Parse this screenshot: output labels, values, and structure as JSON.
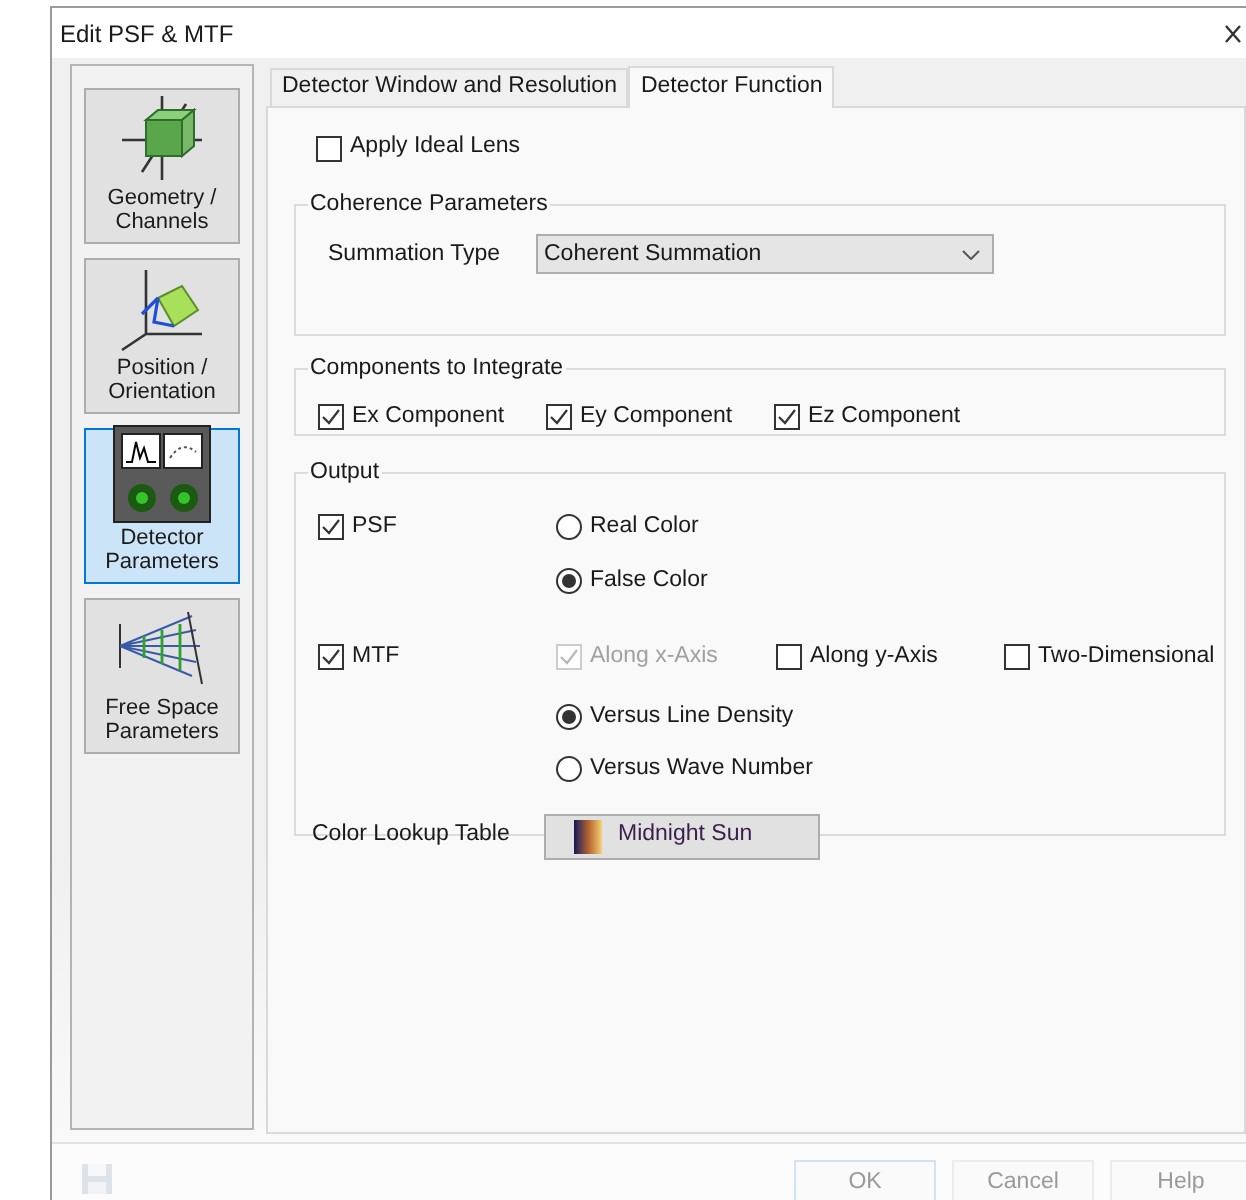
{
  "window": {
    "title": "Edit PSF & MTF"
  },
  "sidebar": {
    "items": [
      {
        "label": "Geometry / Channels",
        "kind": "geometry",
        "selected": false
      },
      {
        "label": "Position / Orientation",
        "kind": "position",
        "selected": false
      },
      {
        "label": "Detector Parameters",
        "kind": "detector",
        "selected": true
      },
      {
        "label": "Free Space Parameters",
        "kind": "freespace",
        "selected": false
      }
    ]
  },
  "tabs": [
    {
      "label": "Detector Window and Resolution",
      "selected": false
    },
    {
      "label": "Detector Function",
      "selected": true
    }
  ],
  "apply_ideal_lens": {
    "label": "Apply Ideal Lens",
    "checked": false
  },
  "coherence": {
    "title": "Coherence Parameters",
    "summation_type": {
      "label": "Summation Type",
      "value": "Coherent Summation"
    }
  },
  "components": {
    "title": "Components to Integrate",
    "items": [
      {
        "label": "Ex Component",
        "checked": true
      },
      {
        "label": "Ey Component",
        "checked": true
      },
      {
        "label": "Ez Component",
        "checked": true
      }
    ]
  },
  "output": {
    "title": "Output",
    "psf": {
      "label": "PSF",
      "checked": true,
      "options": [
        {
          "label": "Real Color",
          "selected": false
        },
        {
          "label": "False Color",
          "selected": true
        }
      ]
    },
    "mtf": {
      "label": "MTF",
      "checked": true,
      "axes": [
        {
          "label": "Along x-Axis",
          "checked": true,
          "disabled": true
        },
        {
          "label": "Along y-Axis",
          "checked": false,
          "disabled": false
        },
        {
          "label": "Two-Dimensional",
          "checked": false,
          "disabled": false
        }
      ],
      "options": [
        {
          "label": "Versus Line Density",
          "selected": true
        },
        {
          "label": "Versus Wave Number",
          "selected": false
        }
      ]
    },
    "color_lookup": {
      "label": "Color Lookup Table",
      "value": "Midnight Sun"
    }
  },
  "footer": {
    "buttons": [
      {
        "label": "OK"
      },
      {
        "label": "Cancel"
      },
      {
        "label": "Help"
      }
    ]
  }
}
